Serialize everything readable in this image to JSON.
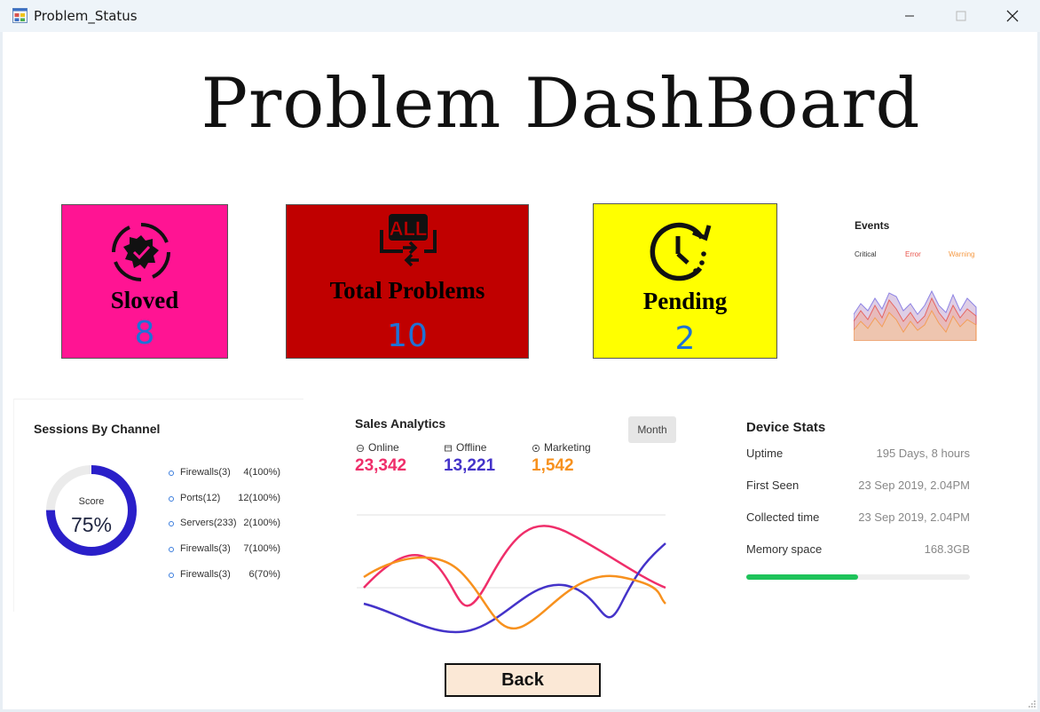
{
  "window": {
    "title": "Problem_Status",
    "icon": "app-form-icon"
  },
  "heading": "Problem DashBoard",
  "cards": {
    "solved": {
      "label": "Sloved",
      "value": "8",
      "icon": "gear-check-icon"
    },
    "total": {
      "label": "Total Problems",
      "value": "10",
      "icon": "all-swap-icon"
    },
    "pending": {
      "label": "Pending",
      "value": "2",
      "icon": "clock-refresh-icon"
    }
  },
  "events": {
    "title": "Events",
    "legend": [
      {
        "label": "Critical",
        "color": "#333333"
      },
      {
        "label": "Error",
        "color": "#e8534a"
      },
      {
        "label": "Warning",
        "color": "#f59a45"
      }
    ]
  },
  "sessions": {
    "title": "Sessions By Channel",
    "score_label": "Score",
    "score_value": "75%",
    "score_fraction": 0.75,
    "ring_color": "#2a1fc9",
    "items": [
      {
        "name": "Firewalls(3)",
        "value": "4(100%)"
      },
      {
        "name": "Ports(12)",
        "value": "12(100%)"
      },
      {
        "name": "Servers(233)",
        "value": "2(100%)"
      },
      {
        "name": "Firewalls(3)",
        "value": "7(100%)"
      },
      {
        "name": "Firewalls(3)",
        "value": "6(70%)"
      }
    ]
  },
  "sales": {
    "title": "Sales Analytics",
    "period_button": "Month",
    "metrics": [
      {
        "label": "Online",
        "value": "23,342",
        "color": "#ef2e6a",
        "icon": "globe-icon"
      },
      {
        "label": "Offline",
        "value": "13,221",
        "color": "#4433c9",
        "icon": "store-icon"
      },
      {
        "label": "Marketing",
        "value": "1,542",
        "color": "#f7911e",
        "icon": "target-icon"
      }
    ]
  },
  "device": {
    "title": "Device Stats",
    "rows": [
      {
        "label": "Uptime",
        "value": "195 Days, 8 hours"
      },
      {
        "label": "First Seen",
        "value": "23 Sep 2019, 2.04PM"
      },
      {
        "label": "Collected time",
        "value": "23 Sep 2019, 2.04PM"
      },
      {
        "label": "Memory space",
        "value": "168.3GB"
      }
    ],
    "memory_fraction": 0.5,
    "bar_color": "#1ec35a"
  },
  "back_button": "Back"
}
